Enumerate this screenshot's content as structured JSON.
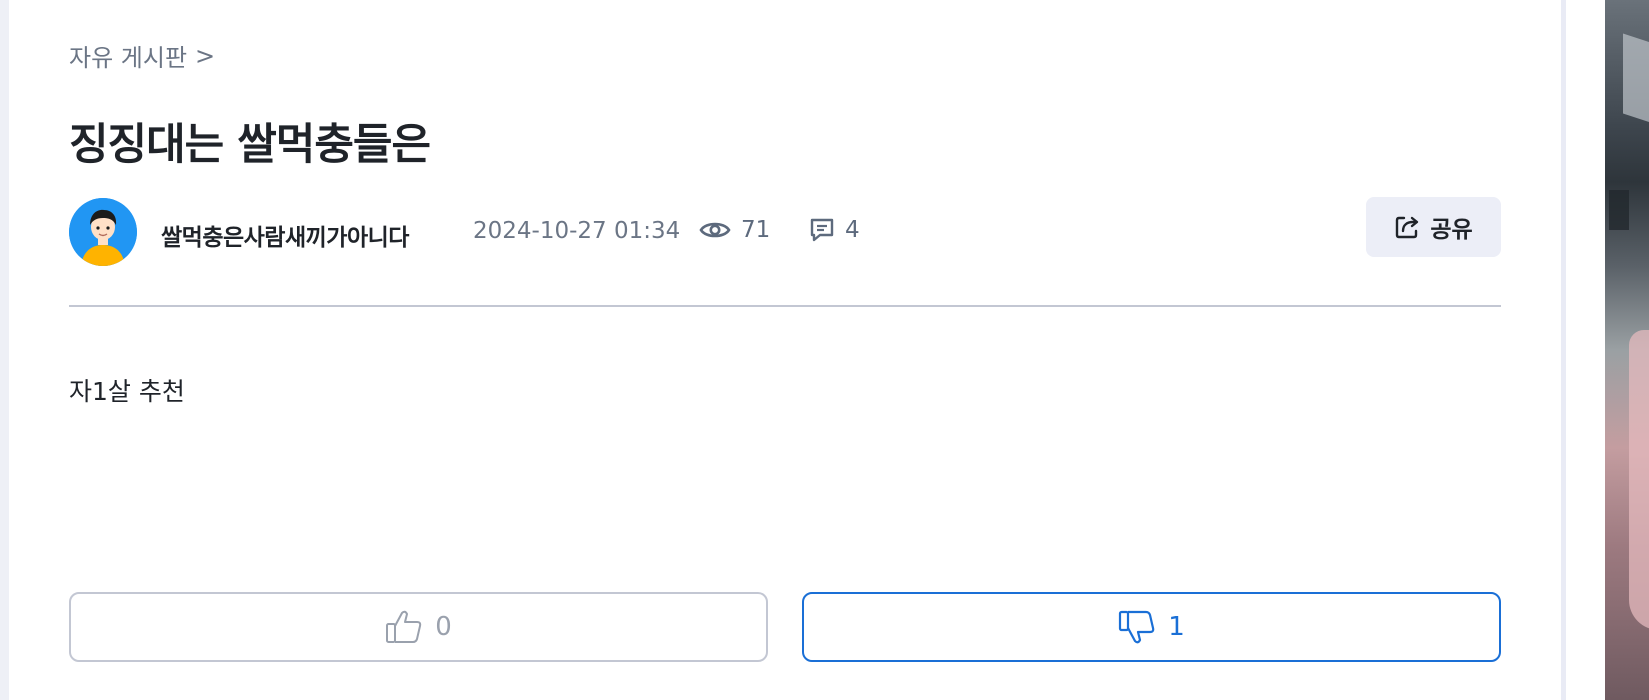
{
  "breadcrumb": {
    "board": "자유 게시판",
    "separator": ">"
  },
  "post": {
    "title": "징징대는 쌀먹충들은",
    "author": "쌀먹충은사람새끼가아니다",
    "date": "2024-10-27 01:34",
    "views": "71",
    "comments": "4",
    "body": "자1살 추천"
  },
  "share": {
    "label": "공유"
  },
  "votes": {
    "like_count": "0",
    "dislike_count": "1"
  },
  "colors": {
    "accent": "#1a6fd6",
    "muted_text": "#6b7585",
    "share_bg": "#eceef7",
    "avatar_bg": "#2196f3"
  },
  "icons": {
    "views": "eye-icon",
    "comments": "comment-icon",
    "share": "share-icon",
    "like": "thumbs-up-icon",
    "dislike": "thumbs-down-icon"
  }
}
